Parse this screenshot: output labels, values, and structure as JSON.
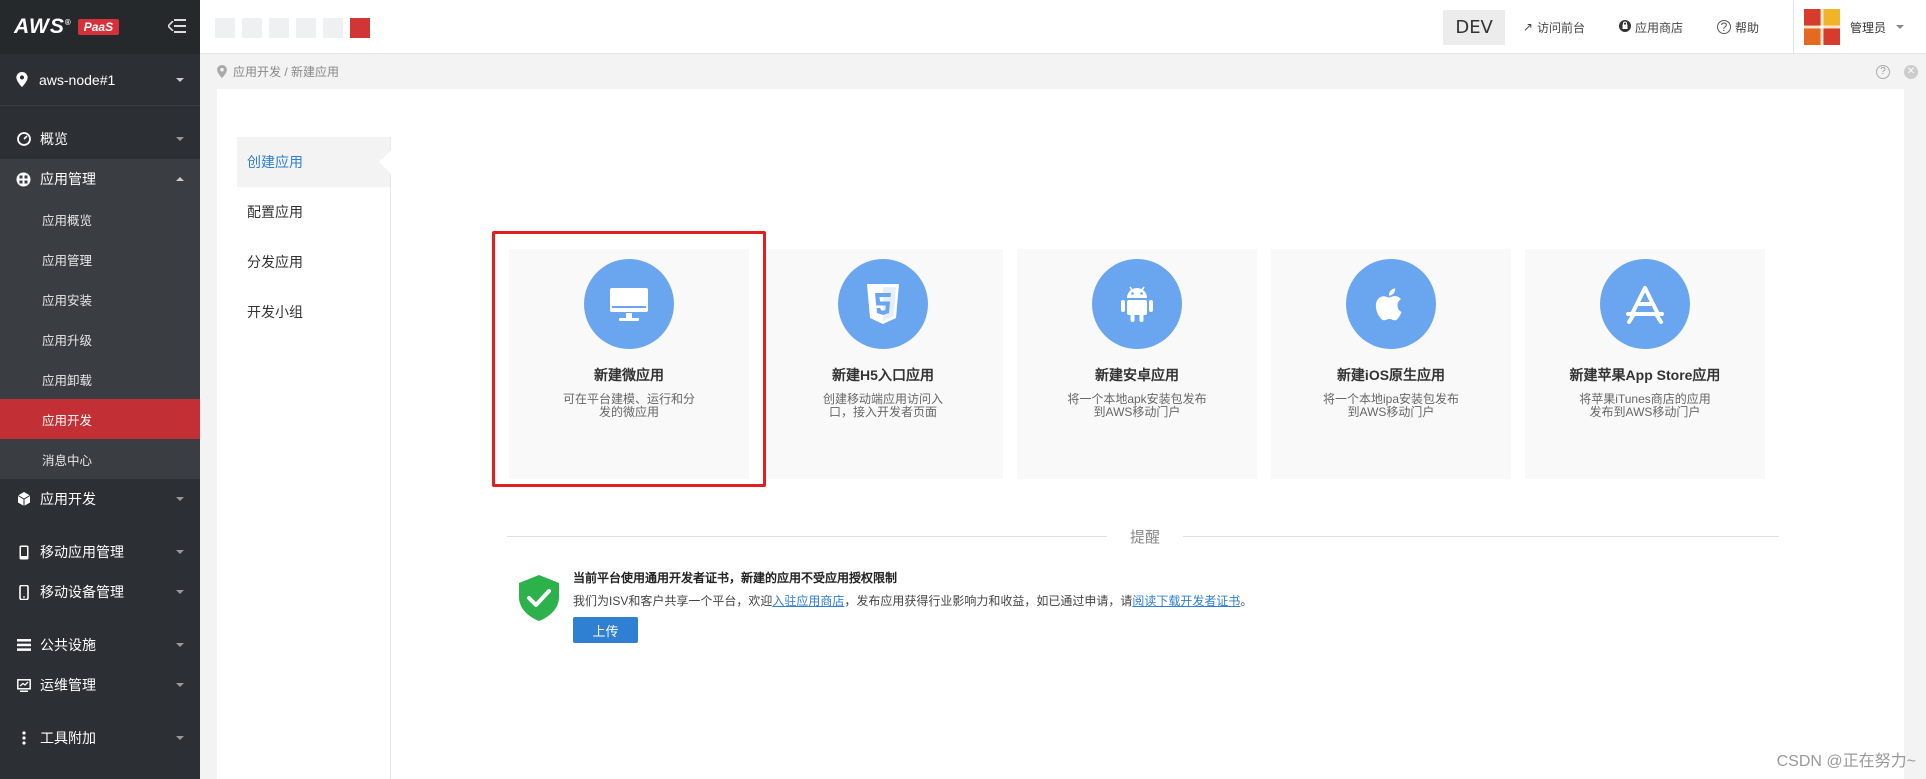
{
  "brand": {
    "name": "AWS",
    "reg": "®",
    "product": "PaaS"
  },
  "node": {
    "label": "aws-node#1"
  },
  "sidebar": {
    "items": [
      {
        "label": "概览"
      },
      {
        "label": "应用管理"
      },
      {
        "label": "应用开发"
      },
      {
        "label": "移动应用管理"
      },
      {
        "label": "移动设备管理"
      },
      {
        "label": "公共设施"
      },
      {
        "label": "运维管理"
      },
      {
        "label": "工具附加"
      }
    ],
    "sub_items": [
      {
        "label": "应用概览"
      },
      {
        "label": "应用管理"
      },
      {
        "label": "应用安装"
      },
      {
        "label": "应用升级"
      },
      {
        "label": "应用卸载"
      },
      {
        "label": "应用开发"
      },
      {
        "label": "消息中心"
      }
    ]
  },
  "topbar": {
    "env": "DEV",
    "links": [
      {
        "label": "访问前台",
        "icon": "external-link-icon"
      },
      {
        "label": "应用商店",
        "icon": "store-icon"
      },
      {
        "label": "帮助",
        "icon": "help-icon"
      }
    ],
    "user": "管理员"
  },
  "breadcrumb": {
    "text": "应用开发 / 新建应用"
  },
  "subnav": [
    {
      "label": "创建应用"
    },
    {
      "label": "配置应用"
    },
    {
      "label": "分发应用"
    },
    {
      "label": "开发小组"
    }
  ],
  "cards": [
    {
      "title": "新建微应用",
      "desc": "可在平台建模、运行和分发的微应用",
      "icon": "monitor-icon"
    },
    {
      "title": "新建H5入口应用",
      "desc": "创建移动端应用访问入口，接入开发者页面",
      "icon": "html5-icon"
    },
    {
      "title": "新建安卓应用",
      "desc": "将一个本地apk安装包发布到AWS移动门户",
      "icon": "android-icon"
    },
    {
      "title": "新建iOS原生应用",
      "desc": "将一个本地ipa安装包发布到AWS移动门户",
      "icon": "apple-icon"
    },
    {
      "title": "新建苹果App Store应用",
      "desc": "将苹果iTunes商店的应用发布到AWS移动门户",
      "icon": "appstore-icon"
    }
  ],
  "notice": {
    "divider": "提醒",
    "title": "当前平台使用通用开发者证书，新建的应用不受应用授权限制",
    "text_1": "我们为ISV和客户共享一个平台，欢迎",
    "link_1": "入驻应用商店",
    "text_2": "，发布应用获得行业影响力和收益，如已通过申请，请",
    "link_2": "阅读下载开发者证书",
    "text_3": "。",
    "button": "上传"
  },
  "watermark": "CSDN @正在努力~",
  "colors": {
    "sidebar_bg": "#2c2f33",
    "active_red": "#c23035",
    "accent_blue": "#2f7fd3",
    "card_icon_blue": "#6aa6ef",
    "shield_green": "#2db14a"
  }
}
